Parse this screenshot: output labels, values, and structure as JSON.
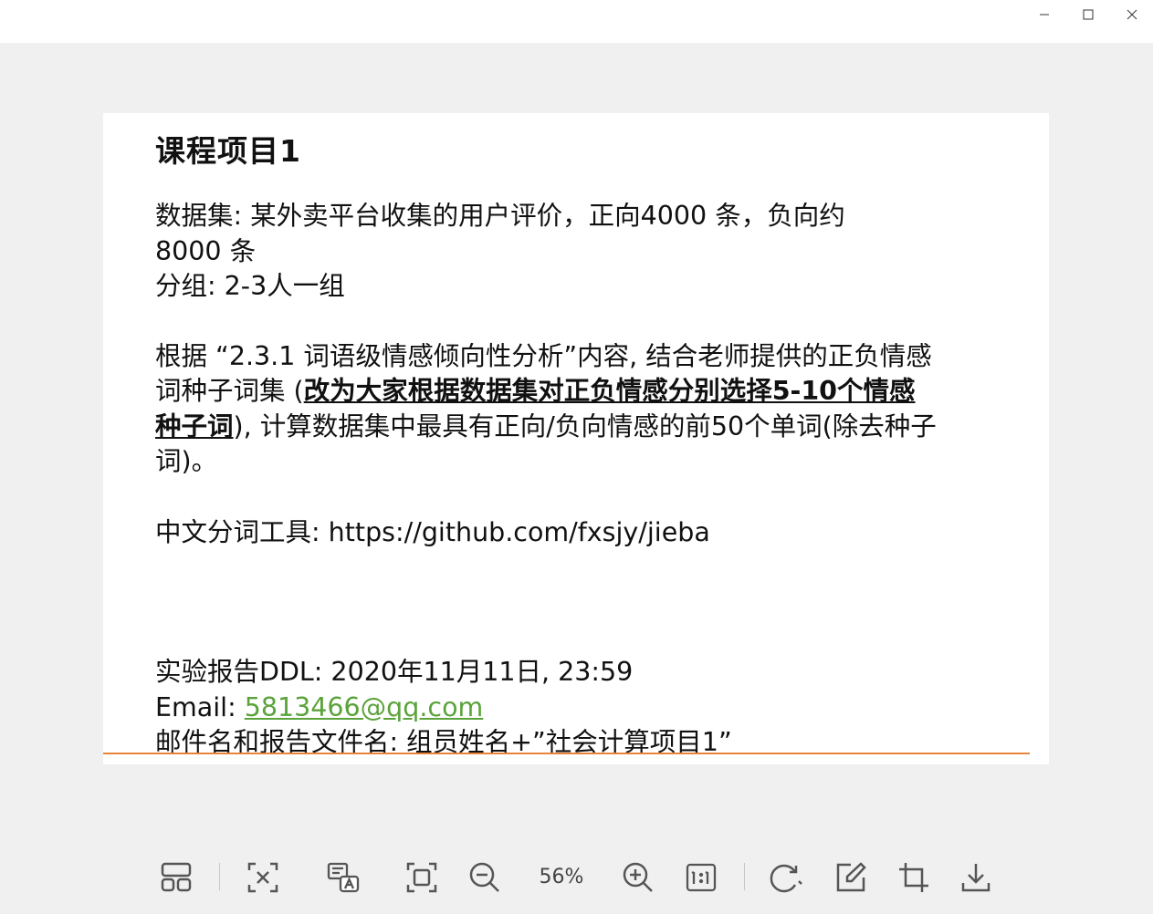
{
  "window": {
    "minimize_icon": "minimize-icon",
    "maximize_icon": "maximize-icon",
    "close_icon": "close-icon"
  },
  "slide": {
    "title": "课程项目1",
    "dataset_line1": "数据集: 某外卖平台收集的用户评价，正向4000 条，负向约",
    "dataset_line2": "8000 条",
    "group_line": "分组: 2-3人一组",
    "para2_a": "根据 “2.3.1  词语级情感倾向性分析”内容, 结合老师提供的正负情感词种子词集 (",
    "para2_b": "改为大家根据数据集对正负情感分别选择5-10个情感种子词",
    "para2_c": "), 计算数据集中最具有正向/负向情感的前50个单词(除去种子词)。",
    "tool_line": "中文分词工具: https://github.com/fxsjy/jieba",
    "ddl_line": "实验报告DDL: 2020年11月11日, 23:59",
    "email_label": "Email: ",
    "email_value": "5813466@qq.com",
    "mail_name_line": "邮件名和报告文件名: 组员姓名+”社会计算项目1”",
    "accent_rule_color": "#e8843a",
    "email_color": "#5aa33b"
  },
  "toolbar": {
    "zoom": "56%",
    "icons": [
      "layout-icon",
      "select-icon",
      "ocr-icon",
      "fit-screen-icon",
      "zoom-out-icon",
      "zoom-in-icon",
      "actual-size-icon",
      "rotate-icon",
      "edit-icon",
      "crop-icon",
      "download-icon"
    ]
  }
}
